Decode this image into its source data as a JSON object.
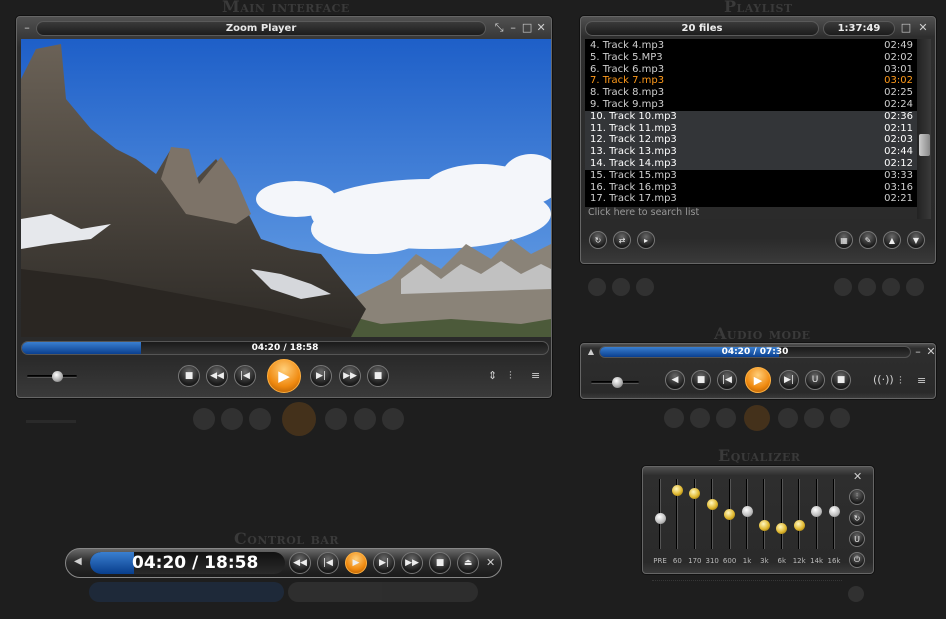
{
  "sections": {
    "main_interface": "Main interface",
    "playlist": "Playlist",
    "audio_mode": "Audio mode",
    "equalizer": "Equalizer",
    "control_bar": "Control bar"
  },
  "main_player": {
    "title": "Zoom Player",
    "time": "04:20 / 18:58",
    "progress": 0.226,
    "volume": 0.6
  },
  "playlist": {
    "count": "20 files",
    "total_time": "1:37:49",
    "search_placeholder": "Click here to search list",
    "tracks": [
      {
        "label": "4. Track 4.mp3",
        "duration": "02:49",
        "state": "plain"
      },
      {
        "label": "5. Track 5.MP3",
        "duration": "02:02",
        "state": "plain"
      },
      {
        "label": "6. Track 6.mp3",
        "duration": "03:01",
        "state": "plain"
      },
      {
        "label": "7. Track 7.mp3",
        "duration": "03:02",
        "state": "active"
      },
      {
        "label": "8. Track 8.mp3",
        "duration": "02:25",
        "state": "plain"
      },
      {
        "label": "9. Track 9.mp3",
        "duration": "02:24",
        "state": "plain"
      },
      {
        "label": "10. Track 10.mp3",
        "duration": "02:36",
        "state": "sel"
      },
      {
        "label": "11. Track 11.mp3",
        "duration": "02:11",
        "state": "sel"
      },
      {
        "label": "12. Track 12.mp3",
        "duration": "02:03",
        "state": "sel"
      },
      {
        "label": "13. Track 13.mp3",
        "duration": "02:44",
        "state": "sel"
      },
      {
        "label": "14. Track 14.mp3",
        "duration": "02:12",
        "state": "sel"
      },
      {
        "label": "15. Track 15.mp3",
        "duration": "03:33",
        "state": "plain"
      },
      {
        "label": "16. Track 16.mp3",
        "duration": "03:16",
        "state": "plain"
      },
      {
        "label": "17. Track 17.mp3",
        "duration": "02:21",
        "state": "plain"
      }
    ]
  },
  "audio_mode": {
    "time": "04:20 / 07:30",
    "progress": 0.578,
    "volume": 0.55
  },
  "equalizer": {
    "bands": [
      "PRE",
      "60",
      "170",
      "310",
      "600",
      "1k",
      "3k",
      "6k",
      "12k",
      "14k",
      "16k"
    ],
    "levels": [
      0.45,
      0.85,
      0.8,
      0.65,
      0.5,
      0.55,
      0.35,
      0.3,
      0.35,
      0.55,
      0.55
    ]
  },
  "control_bar": {
    "time": "04:20 / 18:58",
    "progress": 0.226
  },
  "colors": {
    "accent_orange": "#f08a10",
    "progress_blue": "#1f5fb5",
    "active_track": "#ff9a1a"
  }
}
